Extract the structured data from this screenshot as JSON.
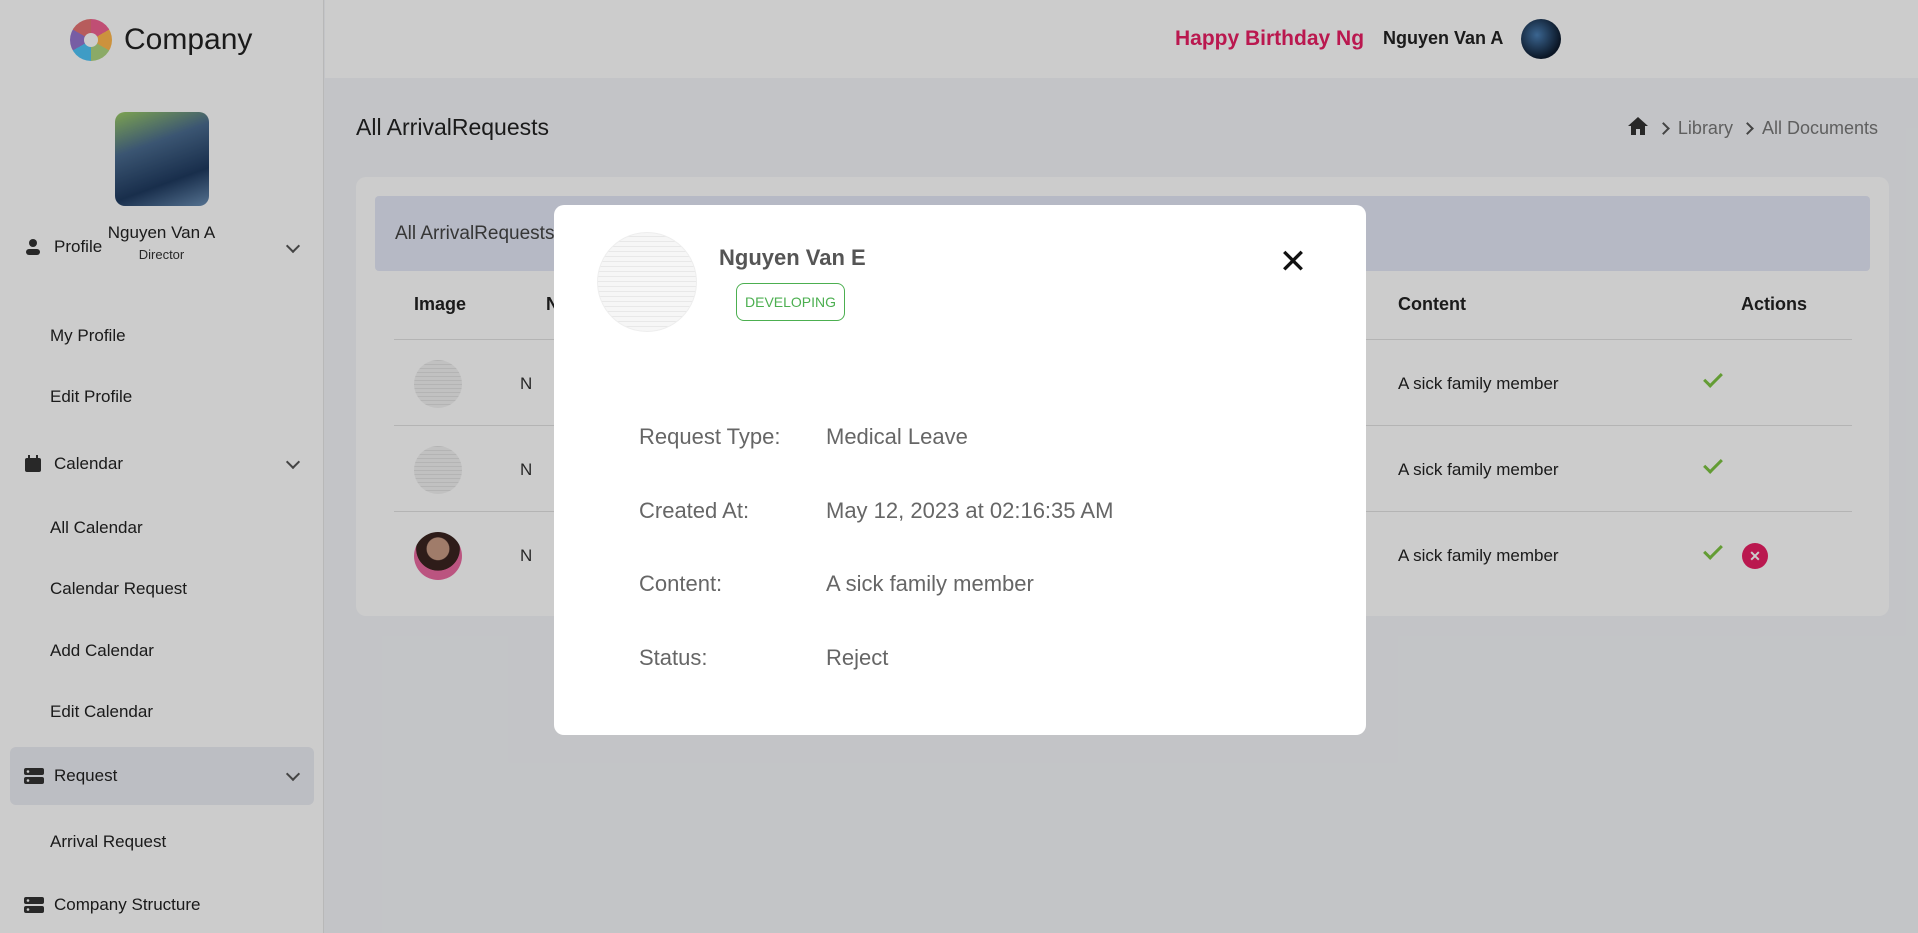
{
  "brand": {
    "name": "Company"
  },
  "profile": {
    "name": "Nguyen Van A",
    "role": "Director"
  },
  "sidebar": {
    "profile_label": "Profile",
    "my_profile": "My Profile",
    "edit_profile": "Edit Profile",
    "calendar_label": "Calendar",
    "all_calendar": "All Calendar",
    "calendar_request": "Calendar Request",
    "add_calendar": "Add Calendar",
    "edit_calendar": "Edit Calendar",
    "request_label": "Request",
    "arrival_request": "Arrival Request",
    "company_structure": "Company Structure"
  },
  "header": {
    "birthday_text": "Happy Birthday Nguyen",
    "user_name": "Nguyen Van A"
  },
  "page": {
    "title": "All ArrivalRequests",
    "breadcrumb": [
      "Library",
      "All Documents"
    ],
    "card_title": "All ArrivalRequests"
  },
  "table": {
    "headers": {
      "image": "Image",
      "name": "N",
      "content": "Content",
      "actions": "Actions"
    },
    "rows": [
      {
        "name": "N",
        "content": "A sick family member"
      },
      {
        "name": "N",
        "content": "A sick family member"
      },
      {
        "name": "N",
        "content": "A sick family member"
      }
    ],
    "reject_glyph": "✕"
  },
  "modal": {
    "name": "Nguyen Van E",
    "badge": "DEVELOPING",
    "close_glyph": "✕",
    "fields": [
      {
        "label": "Request Type:",
        "value": "Medical Leave"
      },
      {
        "label": "Created At:",
        "value": "May 12, 2023 at 02:16:35 AM"
      },
      {
        "label": "Content:",
        "value": "A sick family member"
      },
      {
        "label": "Status:",
        "value": "Reject"
      }
    ]
  },
  "colors": {
    "accent_pink": "#e91e63",
    "success_green": "#7cc341",
    "badge_green": "#4caf50"
  },
  "icons": [
    "logo-icon",
    "user-icon",
    "calendar-icon",
    "request-icon",
    "structure-icon",
    "home-icon",
    "chevron-down-icon",
    "chevron-right-icon",
    "check-icon",
    "close-icon"
  ]
}
